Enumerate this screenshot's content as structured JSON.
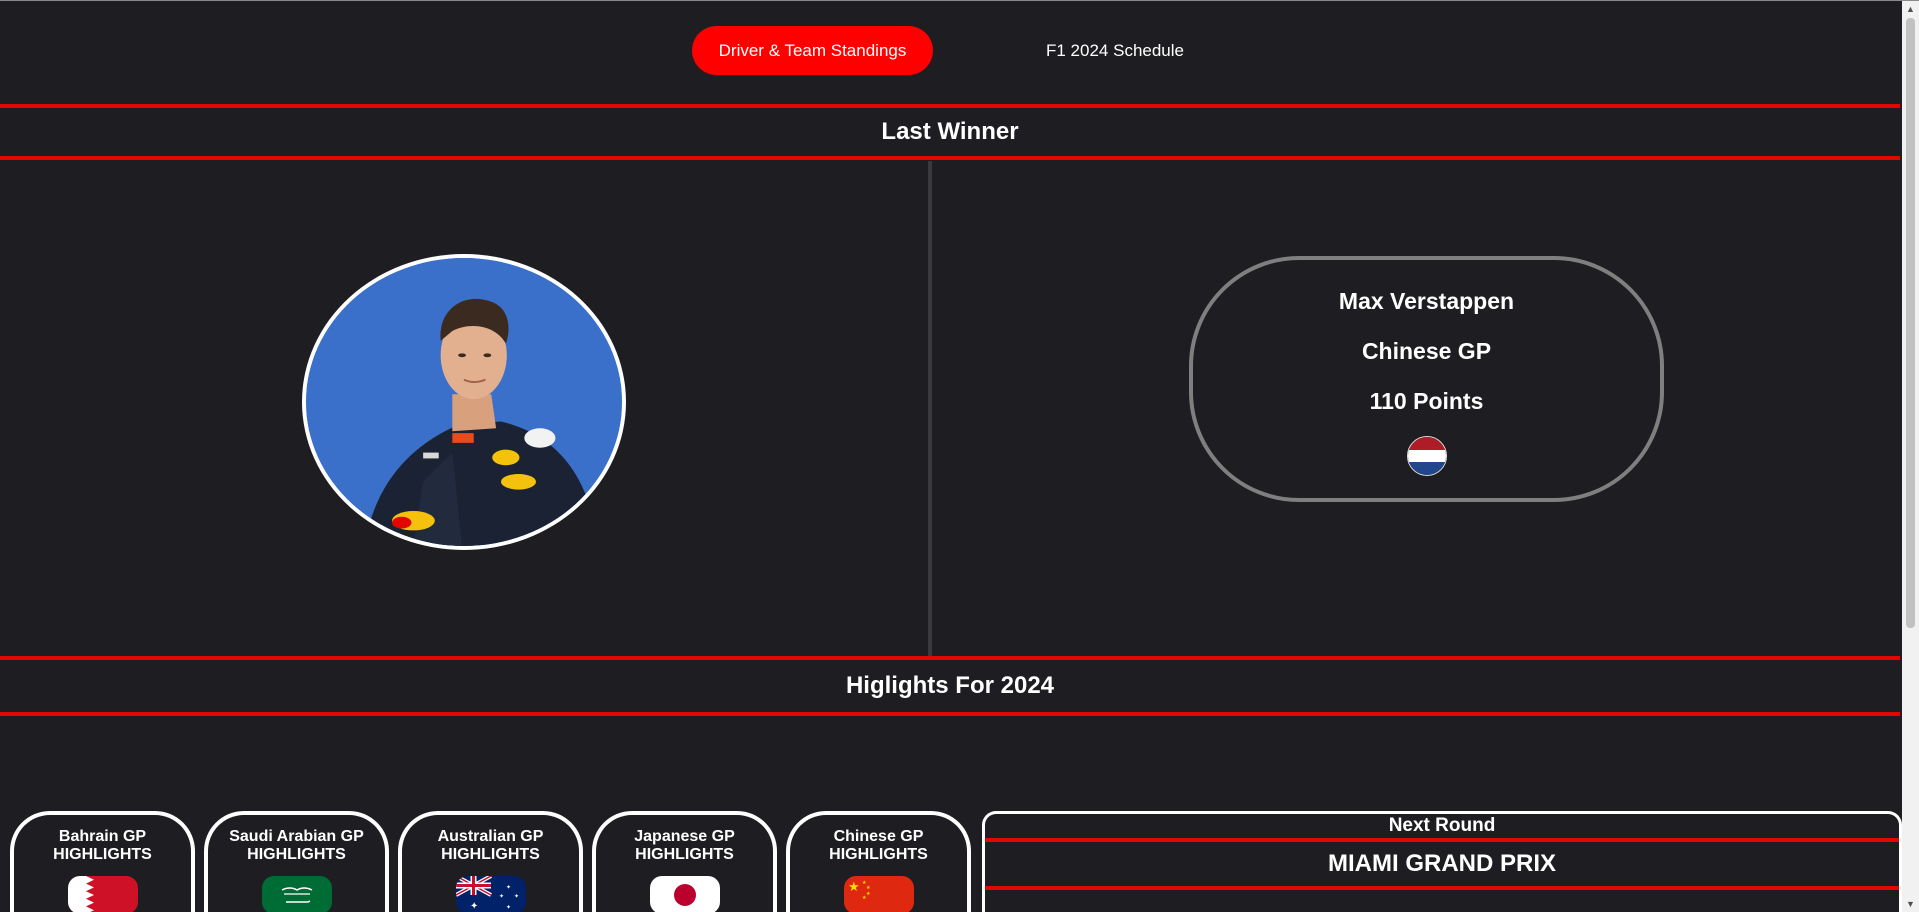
{
  "nav": {
    "standings_label": "Driver & Team Standings",
    "schedule_label": "F1 2024 Schedule"
  },
  "last_winner": {
    "heading": "Last Winner",
    "driver": "Max Verstappen",
    "race": "Chinese GP",
    "points": "110 Points",
    "flag_icon": "netherlands-flag-icon"
  },
  "highlights": {
    "heading": "Higlights For 2024",
    "items": [
      {
        "line1": "Bahrain GP",
        "line2": "HIGHLIGHTS",
        "flag_icon": "bahrain-flag-icon"
      },
      {
        "line1": "Saudi Arabian GP",
        "line2": "HIGHLIGHTS",
        "flag_icon": "saudi-arabia-flag-icon"
      },
      {
        "line1": "Australian GP",
        "line2": "HIGHLIGHTS",
        "flag_icon": "australia-flag-icon"
      },
      {
        "line1": "Japanese GP",
        "line2": "HIGHLIGHTS",
        "flag_icon": "japan-flag-icon"
      },
      {
        "line1": "Chinese GP",
        "line2": "HIGHLIGHTS",
        "flag_icon": "china-flag-icon"
      }
    ]
  },
  "next_round": {
    "label": "Next Round",
    "race": "MIAMI GRAND PRIX"
  },
  "colors": {
    "background": "#1e1d21",
    "accent_red": "#e10600",
    "active_button": "#ff0000",
    "portrait_bg": "#3a70c9"
  }
}
